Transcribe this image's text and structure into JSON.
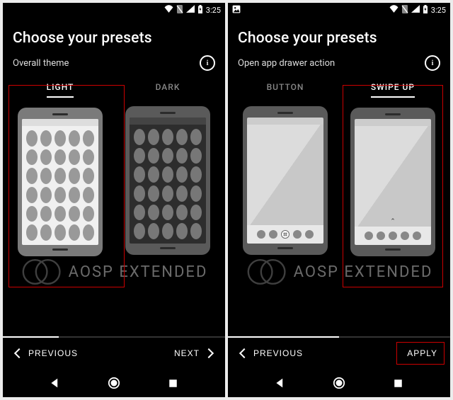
{
  "status": {
    "time": "3:25"
  },
  "screens": [
    {
      "title": "Choose your presets",
      "subtitle": "Overall theme",
      "options": [
        {
          "label": "LIGHT",
          "selected": true
        },
        {
          "label": "DARK",
          "selected": false
        }
      ],
      "progress_pct": 25,
      "footer": {
        "left": "PREVIOUS",
        "right": "NEXT"
      },
      "watermark": "AOSP EXTENDED"
    },
    {
      "title": "Choose your presets",
      "subtitle": "Open app drawer action",
      "options": [
        {
          "label": "BUTTON",
          "selected": false
        },
        {
          "label": "SWIPE UP",
          "selected": true
        }
      ],
      "progress_pct": 50,
      "footer": {
        "left": "PREVIOUS",
        "right": "APPLY"
      },
      "watermark": "AOSP EXTENDED"
    }
  ]
}
